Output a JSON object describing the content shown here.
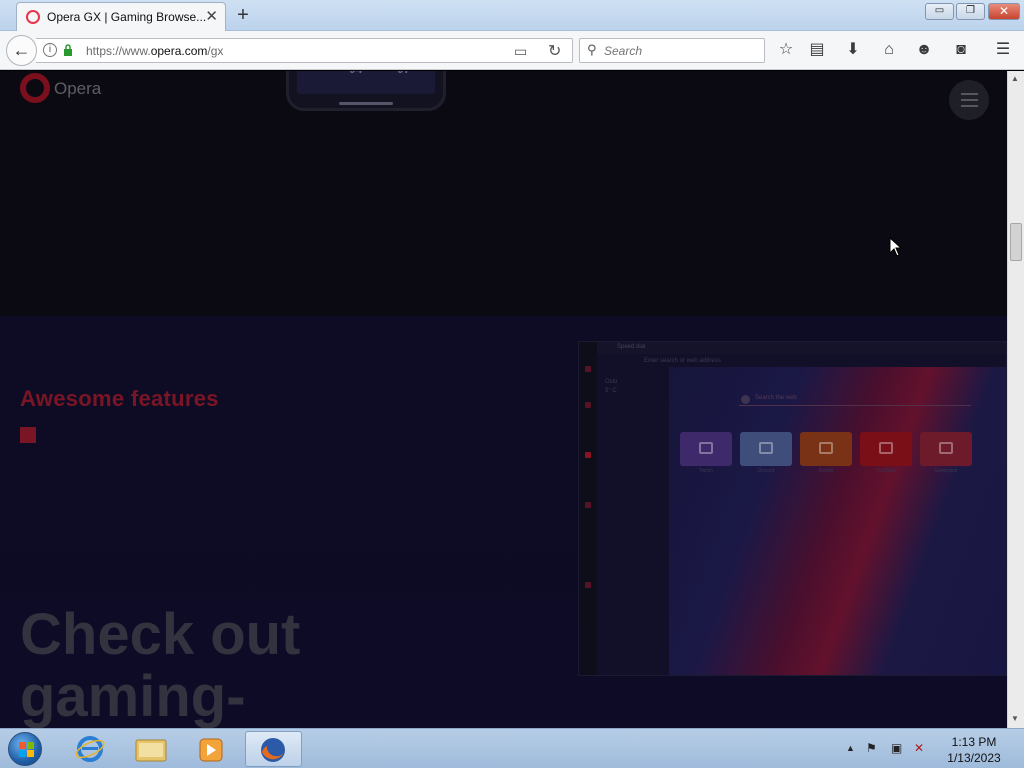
{
  "browser": {
    "tab_title": "Opera GX | Gaming Browse...",
    "tab_close": "✕",
    "new_tab": "+",
    "window": {
      "minimize": "▭",
      "maximize": "❐",
      "close": "✕"
    },
    "url_prefix": "https://www.",
    "url_domain": "opera.com",
    "url_path": "/gx",
    "search_placeholder": "Search",
    "toolbar_icons": [
      "bookmark-star-icon",
      "reading-list-icon",
      "downloads-icon",
      "home-icon",
      "emoji-icon",
      "pocket-icon",
      "hamburger-menu-icon"
    ]
  },
  "page": {
    "logo_text": "Opera",
    "phone_numbers": [
      "04",
      "07"
    ],
    "section_heading": "Awesome features",
    "big_heading": "Check out gaming-",
    "screenshot": {
      "tab_text": "Speed dial",
      "address_text": "Enter search or web address",
      "weather": "Oslo\n5° C",
      "search_text": "Search the web",
      "speed_dials": [
        {
          "label": "Twitch",
          "color": "#3e2a6a",
          "icon": "twitch-icon"
        },
        {
          "label": "Discord",
          "color": "#3f4d7a",
          "icon": "discord-icon"
        },
        {
          "label": "Reddit",
          "color": "#7a3216",
          "icon": "reddit-icon"
        },
        {
          "label": "YouTube",
          "color": "#7b0f18",
          "icon": "youtube-icon"
        },
        {
          "label": "Gamespot",
          "color": "#6d1a2b",
          "icon": "gamespot-icon"
        }
      ]
    }
  },
  "colors": {
    "accent": "#7a1525",
    "heading_dim": "#33323f",
    "page_bg": "#0d0b25"
  },
  "taskbar": {
    "apps": [
      "internet-explorer-icon",
      "windows-explorer-icon",
      "media-player-icon",
      "firefox-icon"
    ],
    "active_app": "firefox-icon",
    "time": "1:13 PM",
    "date": "1/13/2023"
  }
}
